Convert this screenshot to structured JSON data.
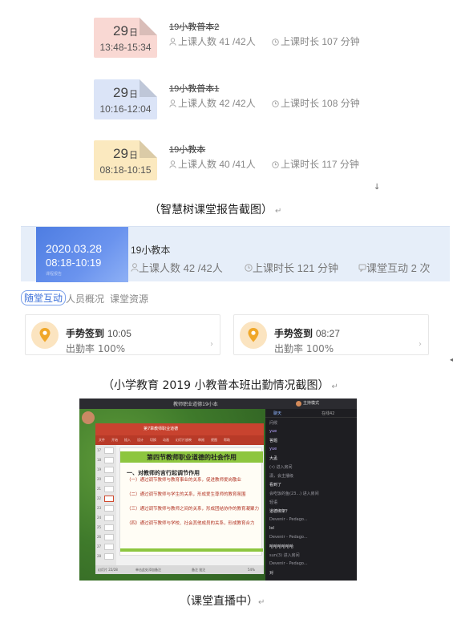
{
  "zhihuishu": {
    "cards": [
      {
        "day": "29",
        "day_unit": "日",
        "time": "13:48-15:34",
        "name": "19小教普本2",
        "attendees_label": "上课人数",
        "attendees": "41 /42人",
        "duration_label": "上课时长",
        "duration": "107 分钟",
        "tile_color": "#f9d8d3"
      },
      {
        "day": "29",
        "day_unit": "日",
        "time": "10:16-12:04",
        "name": "19小教普本1",
        "attendees_label": "上课人数",
        "attendees": "42 /42人",
        "duration_label": "上课时长",
        "duration": "108 分钟",
        "tile_color": "#dbe4f7"
      },
      {
        "day": "29",
        "day_unit": "日",
        "time": "08:18-10:15",
        "name": "19小教本",
        "attendees_label": "上课人数",
        "attendees": "40 /41人",
        "duration_label": "上课时长",
        "duration": "117 分钟",
        "tile_color": "#fbe9bf"
      }
    ],
    "caption": "（智慧树课堂报告截图）"
  },
  "xuexitong": {
    "date": "2020.03.28",
    "time": "08:18-10:19",
    "sub": "课程报告",
    "name": "19小教本",
    "attendees_label": "上课人数",
    "attendees": "42 /42人",
    "duration_label": "上课时长",
    "duration": "121 分钟",
    "interaction_label": "课堂互动",
    "interaction": "2 次",
    "tabs": [
      "随堂互动",
      "人员概况",
      "课堂资源"
    ],
    "signs": [
      {
        "title": "手势签到",
        "time": "10:05",
        "rate_label": "出勤率",
        "rate": "100%"
      },
      {
        "title": "手势签到",
        "time": "08:27",
        "rate_label": "出勤率",
        "rate": "100%"
      }
    ],
    "caption": "（小学教育 2019 小教普本班出勤情况截图）"
  },
  "live": {
    "window_title": "教师职业道德19小本",
    "host": "主持模式",
    "ppt_title": "第7章教师职业道德",
    "ribbon_items": [
      "文件",
      "开始",
      "插入",
      "设计",
      "切换",
      "动画",
      "幻灯片放映",
      "审阅",
      "视图",
      "帮助"
    ],
    "slide_title": "第四节教师职业道德的社会作用",
    "slide_heading": "一、对教师的言行起调节作用",
    "slide_lines": [
      "（一）通过调节教师与教育事业的关系，促进教师爱岗敬业",
      "（二）通过调节教师与学生的关系，形成爱生尊师的教育氛围",
      "（三）通过调节教师与教师之间的关系，形成团结协作的教育凝聚力",
      "（四）通过调节教师与学校、社会其他成员的关系，形成教育合力"
    ],
    "slide_numbers": [
      "17",
      "18",
      "19",
      "20",
      "21",
      "22",
      "23",
      "24",
      "25",
      "26",
      "27",
      "28"
    ],
    "status_left": "幻灯片 22/28",
    "status_notes": "单击此处添加备注",
    "status_right": "备注  批注",
    "zoom": "54%",
    "chat_tabs": [
      "聊天",
      "在线42"
    ],
    "chat": [
      {
        "text": "问候",
        "style": "g"
      },
      {
        "text": "yue",
        "style": "a"
      },
      {
        "text": "答题",
        "style": "w"
      },
      {
        "text": "yue",
        "style": "a"
      },
      {
        "text": "大孟",
        "style": "w"
      },
      {
        "text": "(•) 进入房间",
        "style": "g"
      },
      {
        "text": "潇，会主播级",
        "style": "g"
      },
      {
        "text": "看到了",
        "style": "w"
      },
      {
        "text": "会吃饭的鱼(23...) 进入房间",
        "style": "g"
      },
      {
        "text": "轻语",
        "style": "g"
      },
      {
        "text": "道德绑架？",
        "style": "w"
      },
      {
        "text": "Devenir - Pedago...",
        "style": "g"
      },
      {
        "text": "lol",
        "style": "w"
      },
      {
        "text": "Devenir - Pedago...",
        "style": "g"
      },
      {
        "text": "哈哈哈哈哈哈",
        "style": "w"
      },
      {
        "text": "sun(3) 进入房间",
        "style": "g"
      },
      {
        "text": "Devenir - Pedago...",
        "style": "g"
      },
      {
        "text": "对",
        "style": "w"
      }
    ],
    "caption": "（课堂直播中）"
  },
  "marks": {
    "return": "↵",
    "down": "↓",
    "side": "◂"
  }
}
